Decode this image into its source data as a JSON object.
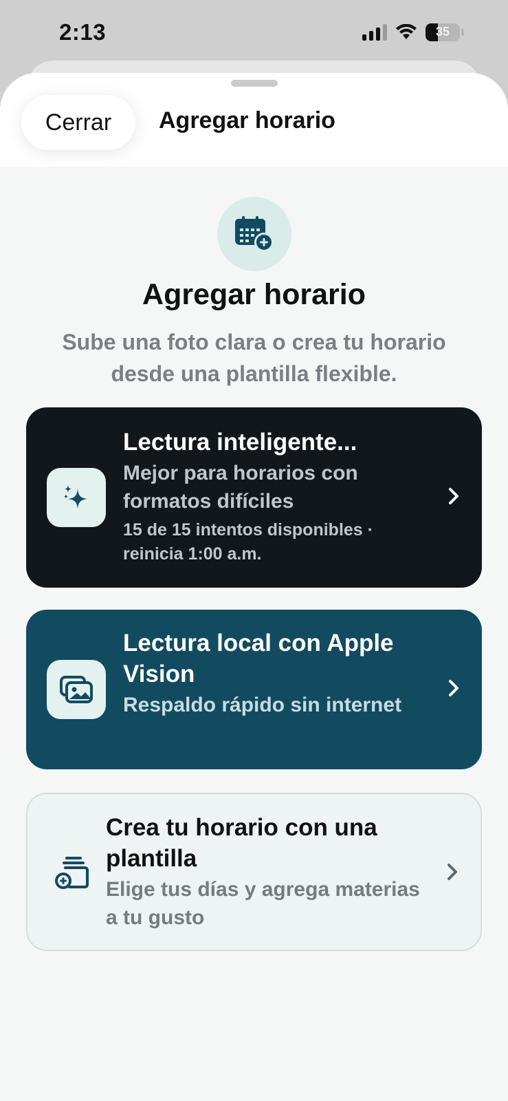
{
  "status_bar": {
    "time": "2:13",
    "battery_percent": "35",
    "signal_bars": 3,
    "wifi": true
  },
  "header": {
    "close_label": "Cerrar",
    "title": "Agregar horario"
  },
  "hero": {
    "icon": "calendar-add-icon",
    "title": "Agregar horario",
    "subtitle": "Sube una foto clara o crea tu horario desde una plantilla flexible."
  },
  "options": [
    {
      "icon": "sparkles-icon",
      "title": "Lectura inteligente...",
      "description": "Mejor para horarios con formatos difíciles",
      "meta": "15 de 15 intentos disponibles · reinicia 1:00 a.m."
    },
    {
      "icon": "photos-icon",
      "title": "Lectura local con Apple Vision",
      "description": "Respaldo rápido sin internet"
    },
    {
      "icon": "template-add-icon",
      "title": "Crea tu horario con una plantilla",
      "description": "Elige tus días y agrega materias a tu gusto"
    }
  ],
  "colors": {
    "accent_teal": "#124b60",
    "dark_card": "#12171c",
    "icon_bg": "#e3f1ef",
    "sheet_bg": "#f4f7f6"
  }
}
